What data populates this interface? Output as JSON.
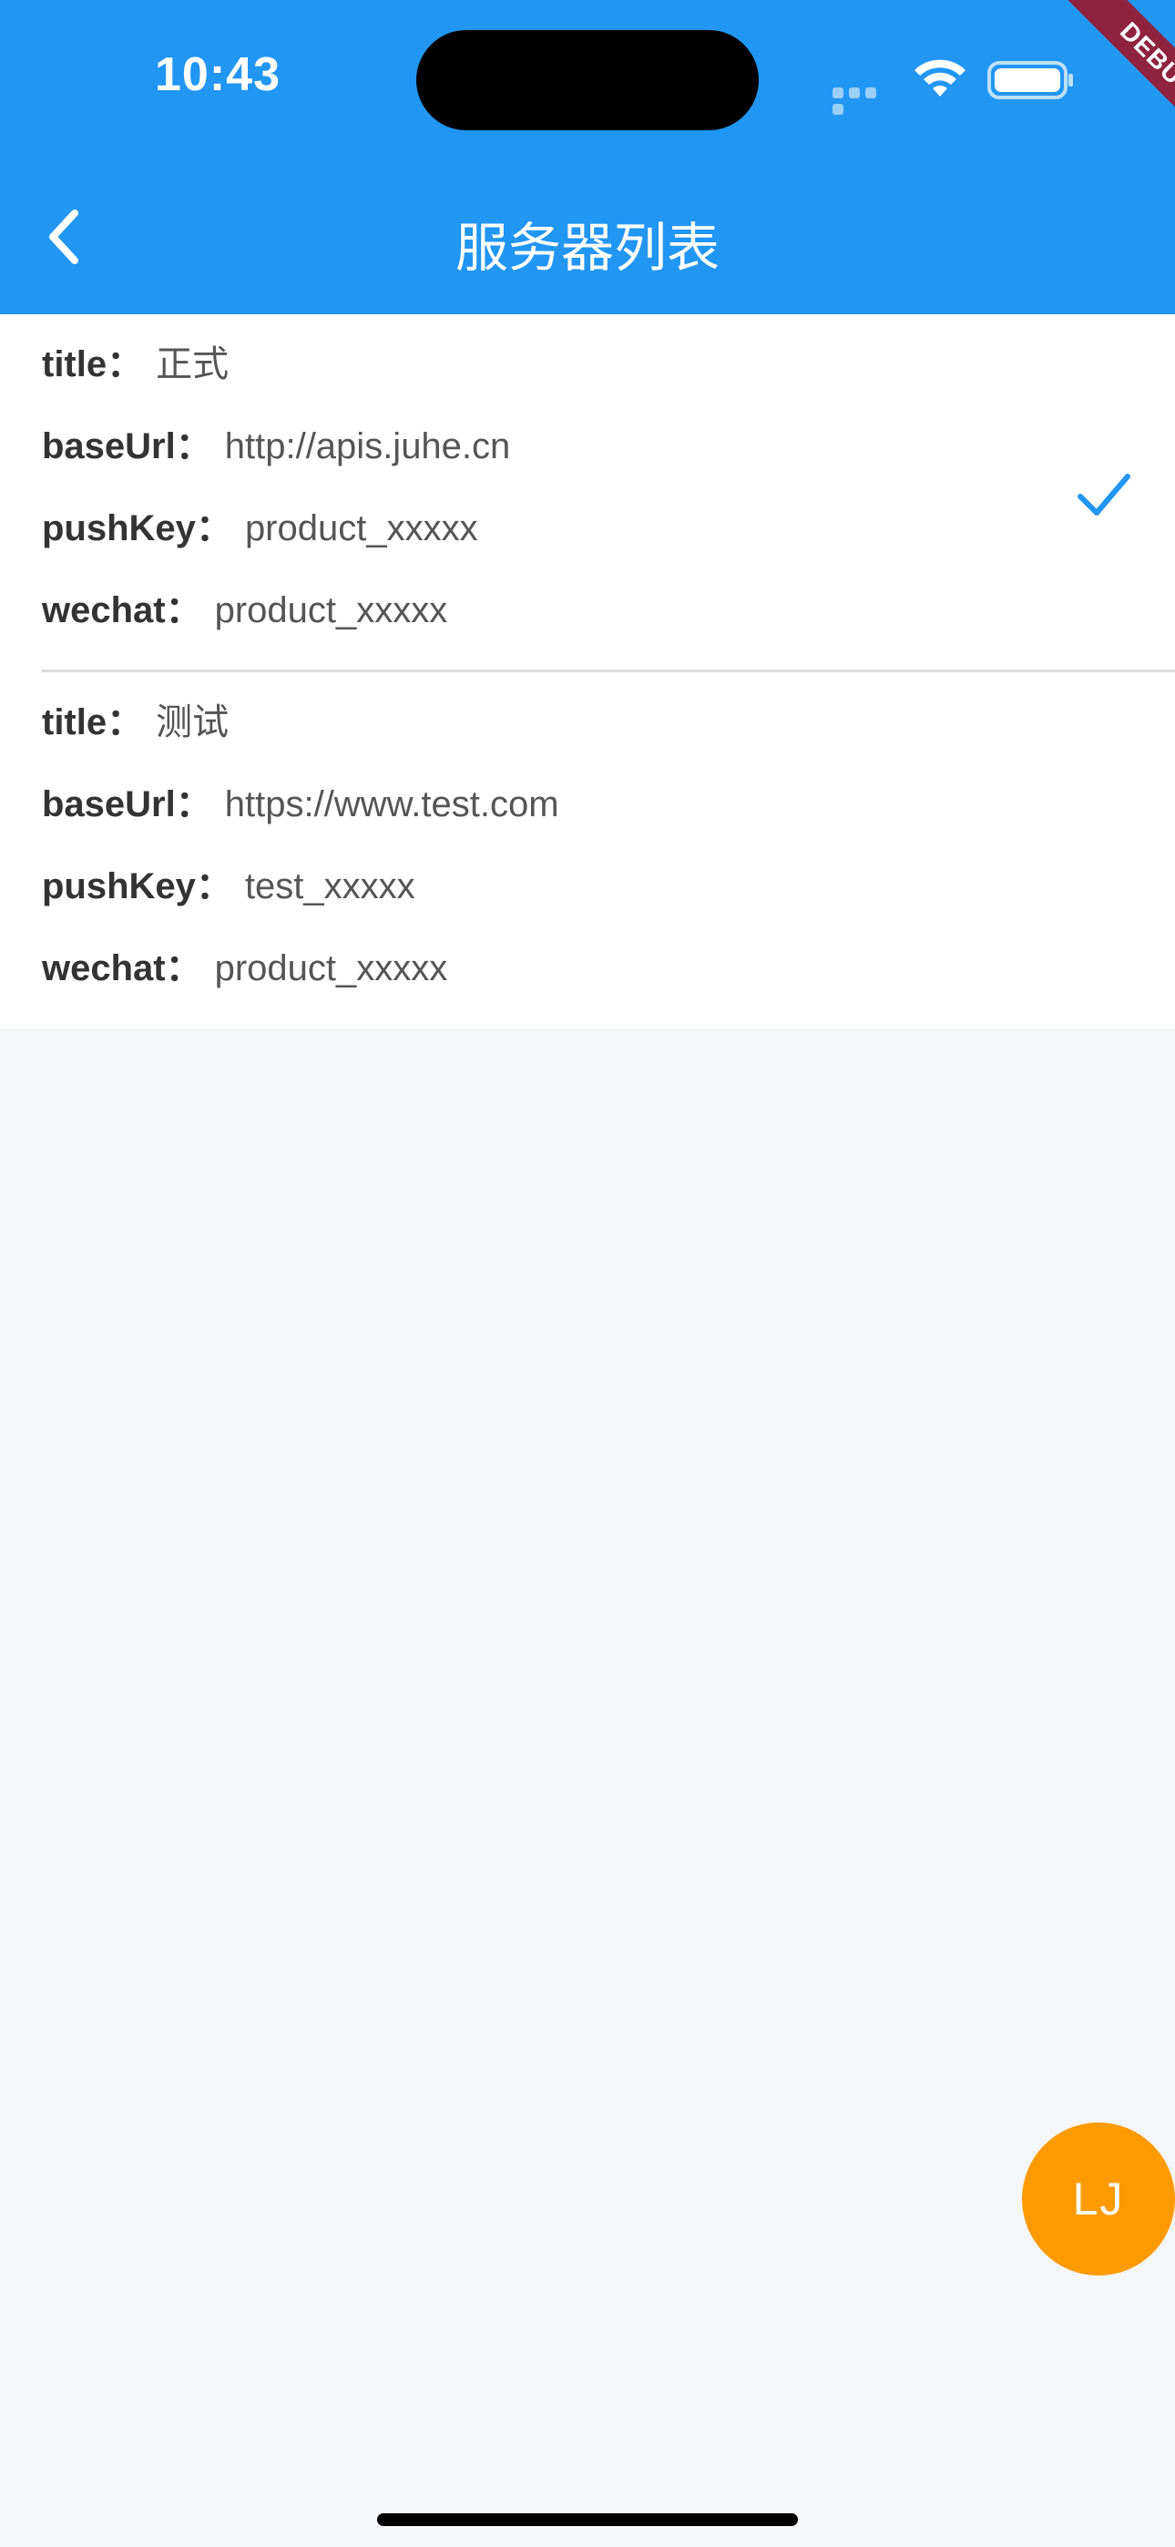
{
  "status_bar": {
    "time": "10:43",
    "debug_label": "DEBUG"
  },
  "app_bar": {
    "title": "服务器列表",
    "back_icon": "chevron-left-icon"
  },
  "servers": [
    {
      "title_label": "title",
      "title_value": "正式",
      "baseurl_label": "baseUrl",
      "baseurl_value": "http://apis.juhe.cn",
      "pushkey_label": "pushKey",
      "pushkey_value": "product_xxxxx",
      "wechat_label": "wechat",
      "wechat_value": "product_xxxxx",
      "selected": true
    },
    {
      "title_label": "title",
      "title_value": "测试",
      "baseurl_label": "baseUrl",
      "baseurl_value": "https://www.test.com",
      "pushkey_label": "pushKey",
      "pushkey_value": "test_xxxxx",
      "wechat_label": "wechat",
      "wechat_value": "product_xxxxx",
      "selected": false
    }
  ],
  "separator": "：",
  "fab": {
    "label": "LJ"
  },
  "colors": {
    "primary": "#2196f3",
    "fab": "#fd9a00",
    "check": "#2196f3",
    "debug_ribbon": "#8e2340"
  }
}
